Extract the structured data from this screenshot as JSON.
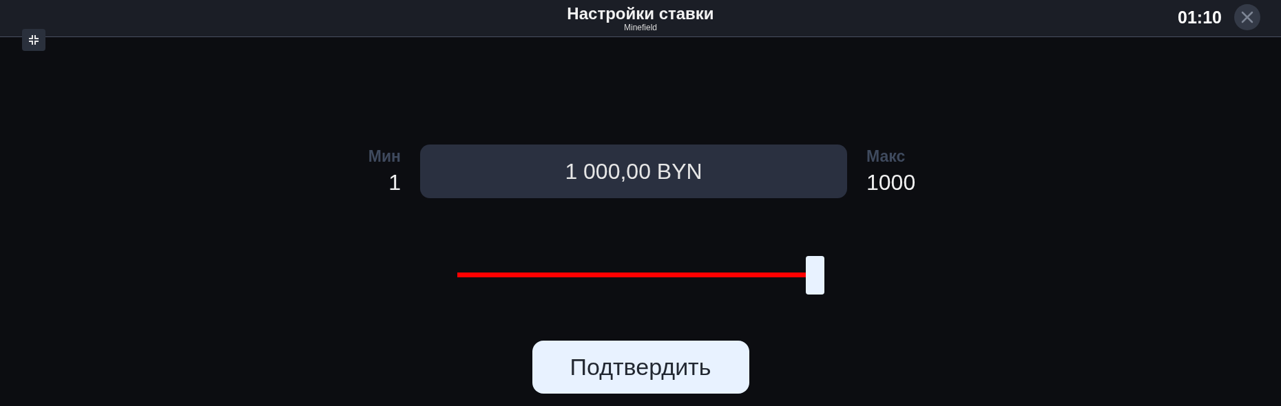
{
  "header": {
    "title": "Настройки ставки",
    "subtitle": "Minefield",
    "timer": "01:10"
  },
  "bet": {
    "min_label": "Мин",
    "min_value": "1",
    "amount": "1 000,00 BYN",
    "max_label": "Макс",
    "max_value": "1000"
  },
  "confirm_button": "Подтвердить"
}
